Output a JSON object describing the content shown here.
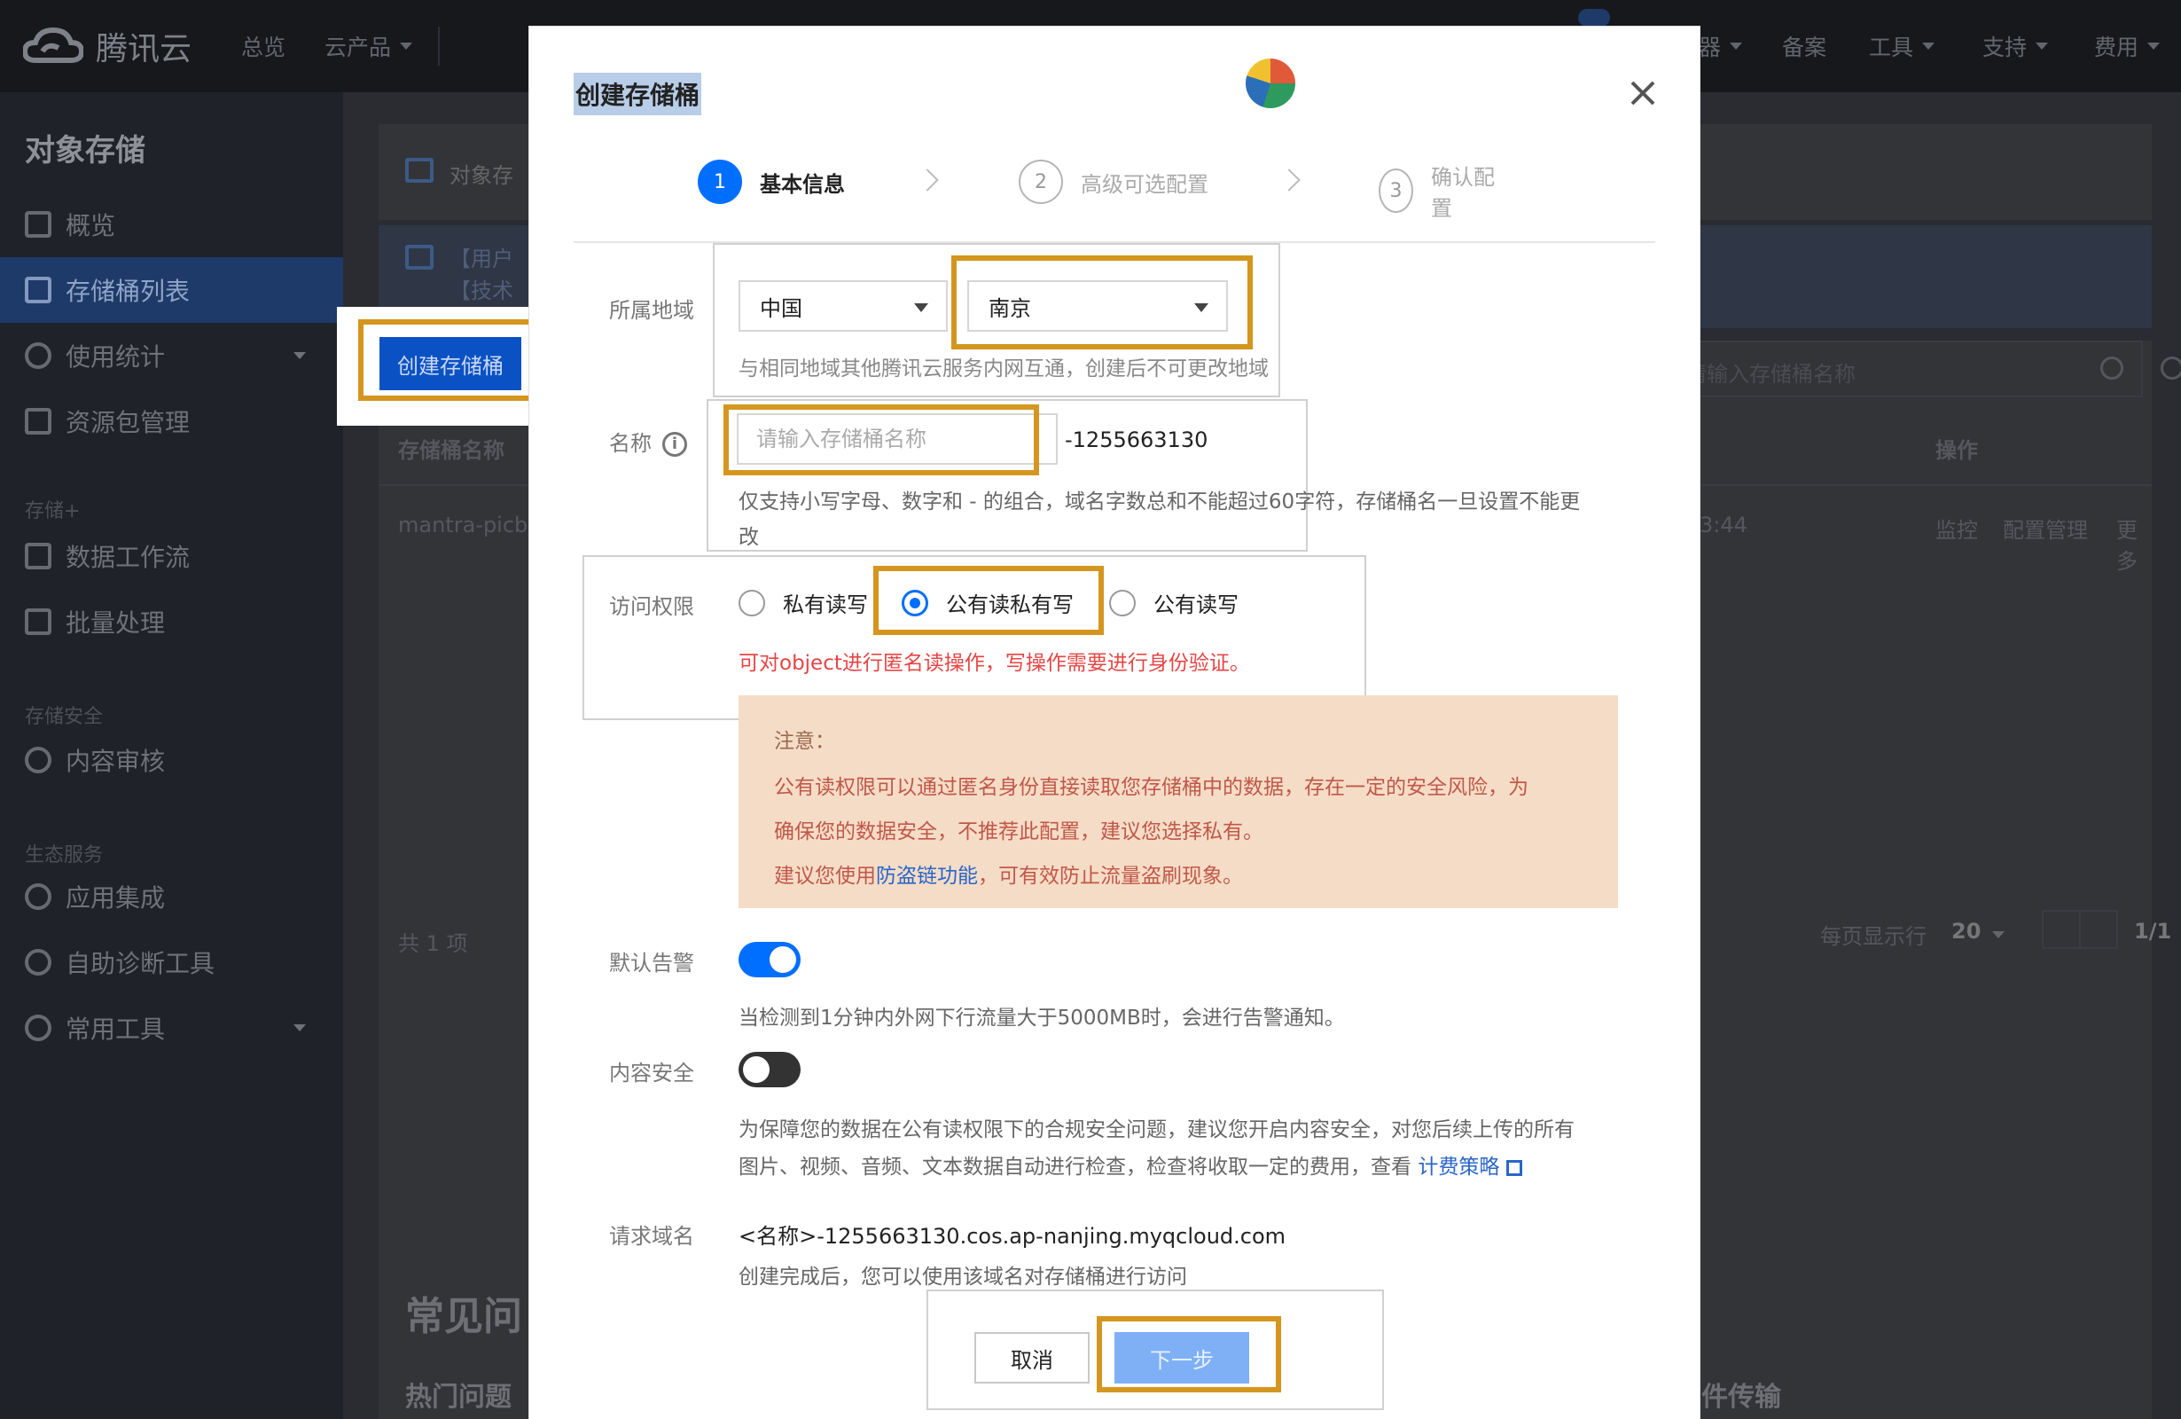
{
  "app": {
    "logo_text": "腾讯云",
    "top_nav": [
      "总览",
      "云产品",
      "备案",
      "工具",
      "支持",
      "费用"
    ],
    "top_nav_partial": "器"
  },
  "sidebar": {
    "title": "对象存储",
    "items": [
      {
        "label": "概览",
        "icon": "grid-icon"
      },
      {
        "label": "存储桶列表",
        "icon": "bucket-icon"
      },
      {
        "label": "使用统计",
        "icon": "chart-icon"
      },
      {
        "label": "资源包管理",
        "icon": "package-icon"
      }
    ],
    "group_storage_plus": "存储+",
    "storage_plus_items": [
      {
        "label": "数据工作流",
        "icon": "workflow-icon"
      },
      {
        "label": "批量处理",
        "icon": "batch-icon"
      }
    ],
    "group_security": "存储安全",
    "security_items": [
      {
        "label": "内容审核",
        "icon": "audit-icon"
      }
    ],
    "group_eco": "生态服务",
    "eco_items": [
      {
        "label": "应用集成",
        "icon": "integration-icon"
      },
      {
        "label": "自助诊断工具",
        "icon": "diagnosis-icon"
      },
      {
        "label": "常用工具",
        "icon": "tools-icon"
      }
    ]
  },
  "background": {
    "notice1": "对象存",
    "notice2a": "【用户",
    "notice2b": "【技术",
    "create_button": "创建存储桶",
    "col_bucket_name": "存储桶名称",
    "col_ops": "操作",
    "row_bucket": "mantra-picbo",
    "row_time": "3:44",
    "row_links": [
      "监控",
      "配置管理",
      "更多"
    ],
    "search_placeholder": "请输入存储桶名称",
    "total": "共 1 项",
    "per_page_label": "每页显示行",
    "per_page_value": "20",
    "page": "1/1",
    "faq_title": "常见问",
    "faq_hot": "热门问题",
    "transfer": "件传输"
  },
  "modal": {
    "title": "创建存储桶",
    "steps": [
      {
        "num": "1",
        "label": "基本信息"
      },
      {
        "num": "2",
        "label": "高级可选配置"
      },
      {
        "num": "3",
        "label": "确认配置"
      }
    ],
    "region": {
      "label": "所属地域",
      "country": "中国",
      "city": "南京",
      "hint": "与相同地域其他腾讯云服务内网互通，创建后不可更改地域"
    },
    "name": {
      "label": "名称",
      "placeholder": "请输入存储桶名称",
      "value": "",
      "suffix": "-1255663130",
      "hint_line1": "仅支持小写字母、数字和 - 的组合，域名字数总和不能超过60字符，存储桶名一旦设置不能更",
      "hint_line2": "改"
    },
    "access": {
      "label": "访问权限",
      "options": [
        "私有读写",
        "公有读私有写",
        "公有读写"
      ],
      "selected": "公有读私有写",
      "warn": "可对object进行匿名读操作，写操作需要进行身份验证。"
    },
    "notice": {
      "title": "注意：",
      "line1": "公有读权限可以通过匿名身份直接读取您存储桶中的数据，存在一定的安全风险，为",
      "line2": "确保您的数据安全，不推荐此配置，建议您选择私有。",
      "line3_pre": "建议您使用",
      "line3_link": "防盗链功能",
      "line3_post": "，可有效防止流量盗刷现象。"
    },
    "alarm": {
      "label": "默认告警",
      "on": true,
      "hint": "当检测到1分钟内外网下行流量大于5000MB时，会进行告警通知。"
    },
    "content_security": {
      "label": "内容安全",
      "on": false,
      "hint_line1": "为保障您的数据在公有读权限下的合规安全问题，建议您开启内容安全，对您后续上传的所有",
      "hint_line2": "图片、视频、音频、文本数据自动进行检查，检查将收取一定的费用，查看",
      "link": "计费策略"
    },
    "domain": {
      "label": "请求域名",
      "value": "<名称>-1255663130.cos.ap-nanjing.myqcloud.com",
      "hint": "创建完成后，您可以使用该域名对存储桶进行访问"
    },
    "buttons": {
      "cancel": "取消",
      "next": "下一步"
    }
  },
  "colors": {
    "primary": "#006eff",
    "highlight": "#d4961e",
    "warning_text": "#e54545",
    "notice_bg": "#f5dcc6"
  }
}
